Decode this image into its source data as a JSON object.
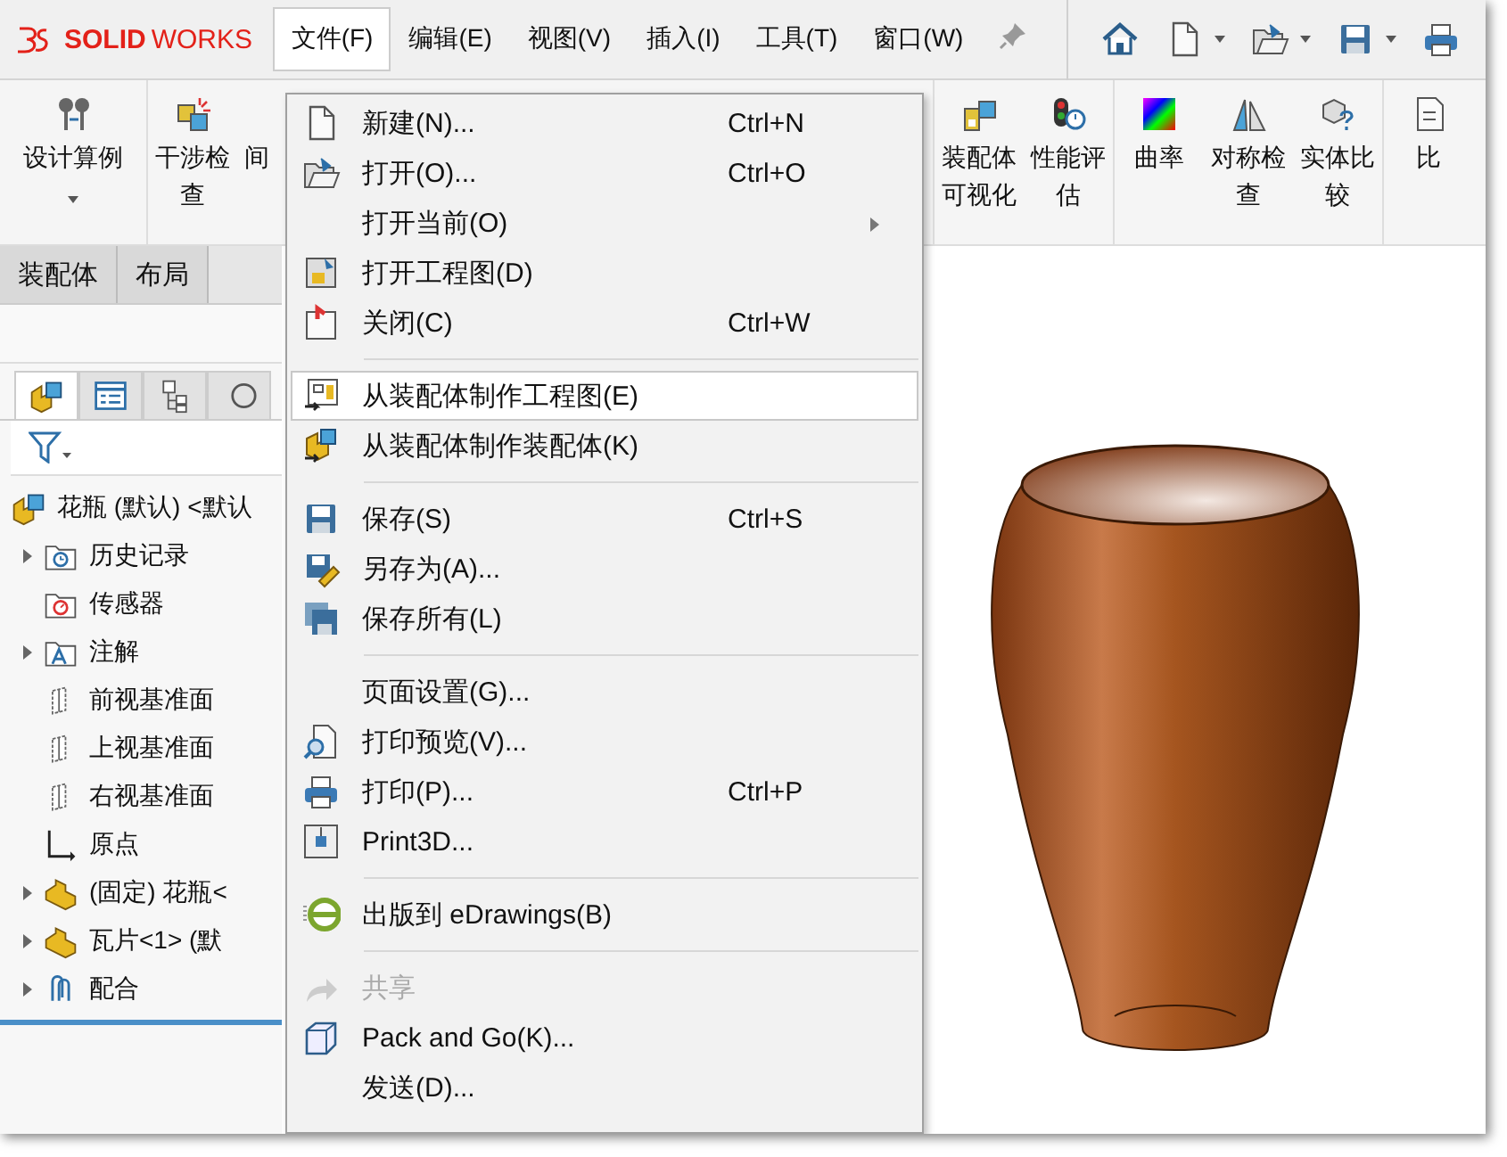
{
  "title_bar": {
    "logo": "**SOLID**WORKS",
    "menus": [
      {
        "label": "文件(F)",
        "selected": true
      },
      {
        "label": "编辑(E)",
        "selected": false
      },
      {
        "label": "视图(V)",
        "selected": false
      },
      {
        "label": "插入(I)",
        "selected": false
      },
      {
        "label": "工具(T)",
        "selected": false
      },
      {
        "label": "窗口(W)",
        "selected": false
      }
    ],
    "quick_access": [
      {
        "kind": "home",
        "dropdown": false
      },
      {
        "kind": "new",
        "dropdown": true
      },
      {
        "kind": "open",
        "dropdown": true
      },
      {
        "kind": "save",
        "dropdown": true
      },
      {
        "kind": "print",
        "dropdown": false
      }
    ]
  },
  "ribbon": {
    "groups": [
      [
        {
          "label": "设计算例",
          "kind": "study",
          "dropdown": true
        }
      ],
      [
        {
          "label": "干涉检查",
          "kind": "interference",
          "dropdown": false
        },
        {
          "label": "间",
          "kind": "hidden",
          "dropdown": false
        }
      ],
      [
        {
          "label": "装配体可视化",
          "kind": "visualize",
          "dropdown": false
        },
        {
          "label": "性能评估",
          "kind": "performance",
          "dropdown": false
        }
      ],
      [
        {
          "label": "曲率",
          "kind": "curvature",
          "dropdown": false
        },
        {
          "label": "对称检查",
          "kind": "symmetry",
          "dropdown": false
        },
        {
          "label": "实体比较",
          "kind": "compare",
          "dropdown": false
        }
      ],
      [
        {
          "label": "比",
          "kind": "document",
          "dropdown": false
        }
      ]
    ]
  },
  "command_tabs": [
    {
      "label": "装配体"
    },
    {
      "label": "布局"
    }
  ],
  "panel_tabs": [
    {
      "kind": "feature-tree",
      "selected": true
    },
    {
      "kind": "property-list",
      "selected": false
    },
    {
      "kind": "configuration",
      "selected": false
    },
    {
      "kind": "target",
      "selected": false
    }
  ],
  "tree": {
    "label": "花瓶 (默认) <默认",
    "kind": "assembly",
    "children": [
      {
        "label": "历史记录",
        "kind": "history",
        "has_children": true
      },
      {
        "label": "传感器",
        "kind": "sensor",
        "has_children": false
      },
      {
        "label": "注解",
        "kind": "annotation",
        "has_children": true
      },
      {
        "label": "前视基准面",
        "kind": "plane",
        "has_children": false
      },
      {
        "label": "上视基准面",
        "kind": "plane",
        "has_children": false
      },
      {
        "label": "右视基准面",
        "kind": "plane",
        "has_children": false
      },
      {
        "label": "原点",
        "kind": "origin",
        "has_children": false
      },
      {
        "label": "(固定) 花瓶<",
        "kind": "part",
        "has_children": true
      },
      {
        "label": "瓦片<1> (默",
        "kind": "part",
        "has_children": true
      },
      {
        "label": "配合",
        "kind": "mates",
        "has_children": true
      }
    ]
  },
  "file_menu": [
    {
      "kind": "item",
      "label": "新建(N)...",
      "shortcut": "Ctrl+N",
      "submenu": false,
      "disabled": false,
      "selected": false
    },
    {
      "kind": "item",
      "label": "打开(O)...",
      "shortcut": "Ctrl+O",
      "submenu": false,
      "disabled": false,
      "selected": false
    },
    {
      "kind": "item",
      "label": "打开当前(O)",
      "submenu": true,
      "disabled": false,
      "selected": false
    },
    {
      "kind": "item",
      "label": "打开工程图(D)",
      "submenu": false,
      "disabled": false,
      "selected": false
    },
    {
      "kind": "item",
      "label": "关闭(C)",
      "shortcut": "Ctrl+W",
      "submenu": false,
      "disabled": false,
      "selected": false
    },
    {
      "kind": "separator"
    },
    {
      "kind": "item",
      "label": "从装配体制作工程图(E)",
      "submenu": false,
      "disabled": false,
      "selected": true
    },
    {
      "kind": "item",
      "label": "从装配体制作装配体(K)",
      "submenu": false,
      "disabled": false,
      "selected": false
    },
    {
      "kind": "separator"
    },
    {
      "kind": "item",
      "label": "保存(S)",
      "shortcut": "Ctrl+S",
      "submenu": false,
      "disabled": false,
      "selected": false
    },
    {
      "kind": "item",
      "label": "另存为(A)...",
      "submenu": false,
      "disabled": false,
      "selected": false
    },
    {
      "kind": "item",
      "label": "保存所有(L)",
      "submenu": false,
      "disabled": false,
      "selected": false
    },
    {
      "kind": "separator"
    },
    {
      "kind": "item",
      "label": "页面设置(G)...",
      "submenu": false,
      "disabled": false,
      "selected": false
    },
    {
      "kind": "item",
      "label": "打印预览(V)...",
      "submenu": false,
      "disabled": false,
      "selected": false
    },
    {
      "kind": "item",
      "label": "打印(P)...",
      "shortcut": "Ctrl+P",
      "submenu": false,
      "disabled": false,
      "selected": false
    },
    {
      "kind": "item",
      "label": "Print3D...",
      "submenu": false,
      "disabled": false,
      "selected": false
    },
    {
      "kind": "separator"
    },
    {
      "kind": "item",
      "label": "出版到 eDrawings(B)",
      "submenu": false,
      "disabled": false,
      "selected": false
    },
    {
      "kind": "separator"
    },
    {
      "kind": "item",
      "label": "共享",
      "submenu": false,
      "disabled": true,
      "selected": false
    },
    {
      "kind": "item",
      "label": "Pack and Go(K)...",
      "submenu": false,
      "disabled": false,
      "selected": false
    },
    {
      "kind": "item",
      "label": "发送(D)...",
      "submenu": false,
      "disabled": false,
      "selected": false
    }
  ]
}
